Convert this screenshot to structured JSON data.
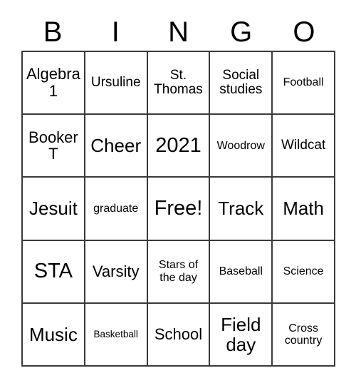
{
  "card": {
    "header_letters": [
      "B",
      "I",
      "N",
      "G",
      "O"
    ],
    "background_color": "#ffffff",
    "border_color": "#3a3a3a",
    "text_color": "#000000",
    "rows": 5,
    "columns": 5,
    "cells": [
      [
        {
          "text": "Algebra 1",
          "size": "fs-md"
        },
        {
          "text": "Ursuline",
          "size": "fs-sm"
        },
        {
          "text": "St. Thomas",
          "size": "fs-sm"
        },
        {
          "text": "Social studies",
          "size": "fs-sm"
        },
        {
          "text": "Football",
          "size": "fs-xs"
        }
      ],
      [
        {
          "text": "Booker T",
          "size": "fs-md"
        },
        {
          "text": "Cheer",
          "size": "fs-lg"
        },
        {
          "text": "2021",
          "size": "fs-xl"
        },
        {
          "text": "Woodrow",
          "size": "fs-xs"
        },
        {
          "text": "Wildcat",
          "size": "fs-sm"
        }
      ],
      [
        {
          "text": "Jesuit",
          "size": "fs-lg"
        },
        {
          "text": "graduate",
          "size": "fs-xs"
        },
        {
          "text": "Free!",
          "size": "fs-xl"
        },
        {
          "text": "Track",
          "size": "fs-lg"
        },
        {
          "text": "Math",
          "size": "fs-lg"
        }
      ],
      [
        {
          "text": "STA",
          "size": "fs-xl"
        },
        {
          "text": "Varsity",
          "size": "fs-md"
        },
        {
          "text": "Stars of the day",
          "size": "fs-xs"
        },
        {
          "text": "Baseball",
          "size": "fs-xs"
        },
        {
          "text": "Science",
          "size": "fs-xs"
        }
      ],
      [
        {
          "text": "Music",
          "size": "fs-lg"
        },
        {
          "text": "Basketball",
          "size": "fs-xxs"
        },
        {
          "text": "School",
          "size": "fs-md"
        },
        {
          "text": "Field day",
          "size": "fs-lg"
        },
        {
          "text": "Cross country",
          "size": "fs-xs"
        }
      ]
    ]
  }
}
